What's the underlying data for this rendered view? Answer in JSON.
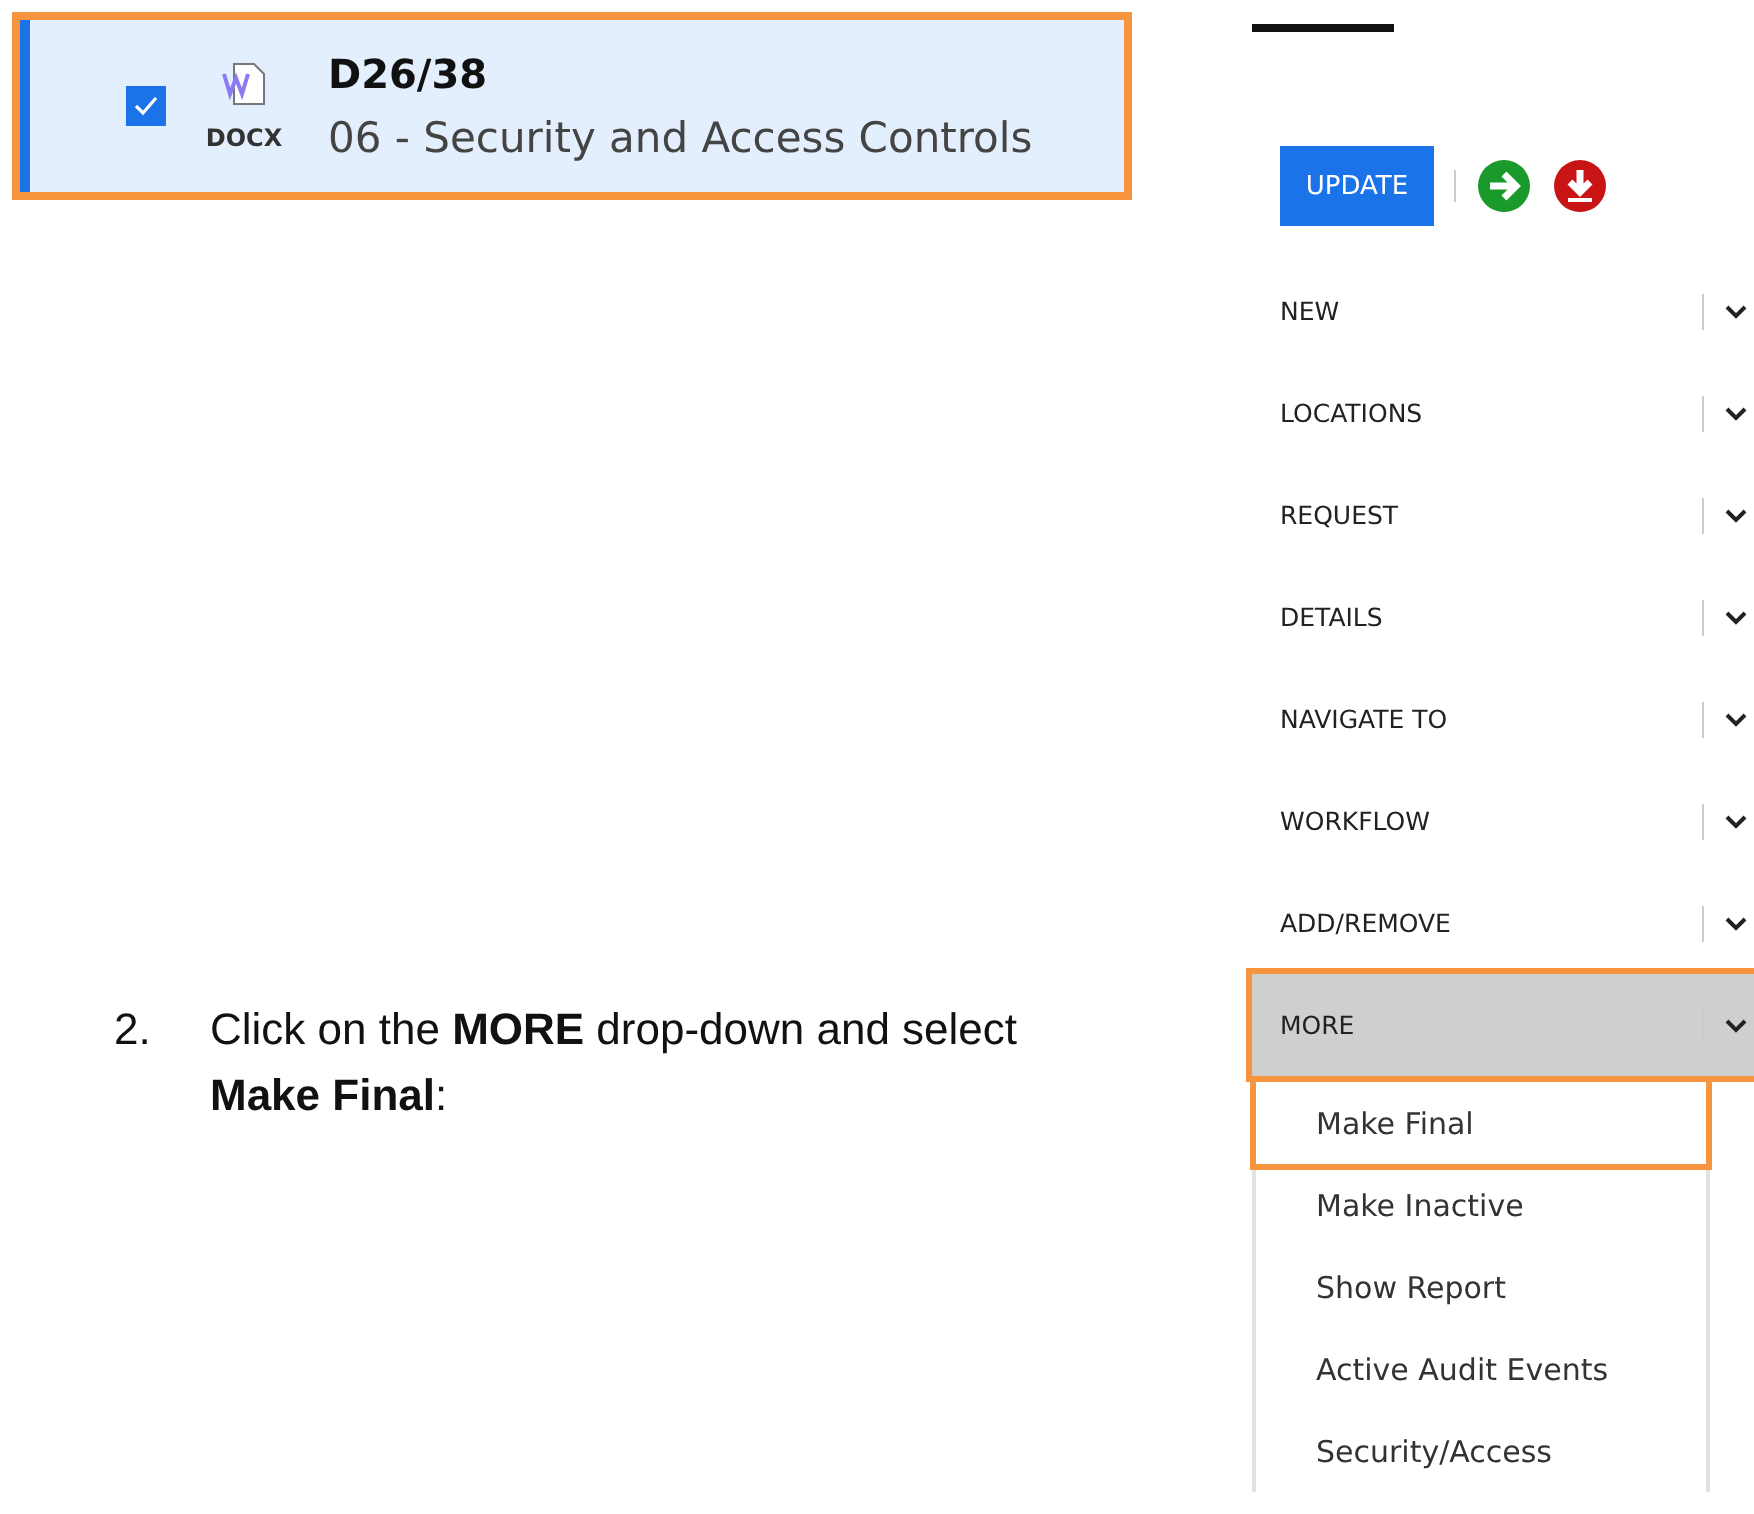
{
  "record": {
    "checked": true,
    "callout": true,
    "file_type": "DOCX",
    "number": "D26/38",
    "title": "06 - Security and Access Controls"
  },
  "instruction": {
    "number": "2.",
    "text": "Click on the **MORE** drop-down and select **Make Final**:"
  },
  "toolbar": {
    "update_button": "UPDATE"
  },
  "menu": [
    {
      "label": "NEW",
      "selected": false,
      "callout": false
    },
    {
      "label": "LOCATIONS",
      "selected": false,
      "callout": false
    },
    {
      "label": "REQUEST",
      "selected": false,
      "callout": false
    },
    {
      "label": "DETAILS",
      "selected": false,
      "callout": false
    },
    {
      "label": "NAVIGATE TO",
      "selected": false,
      "callout": false
    },
    {
      "label": "WORKFLOW",
      "selected": false,
      "callout": false
    },
    {
      "label": "ADD/REMOVE",
      "selected": false,
      "callout": false
    },
    {
      "label": "MORE",
      "selected": true,
      "callout": true
    }
  ],
  "dropdown": [
    {
      "label": "Make Final",
      "callout": true
    },
    {
      "label": "Make Inactive",
      "callout": false
    },
    {
      "label": "Show Report",
      "callout": false
    },
    {
      "label": "Active Audit Events",
      "callout": false
    },
    {
      "label": "Security/Access",
      "callout": false
    }
  ]
}
